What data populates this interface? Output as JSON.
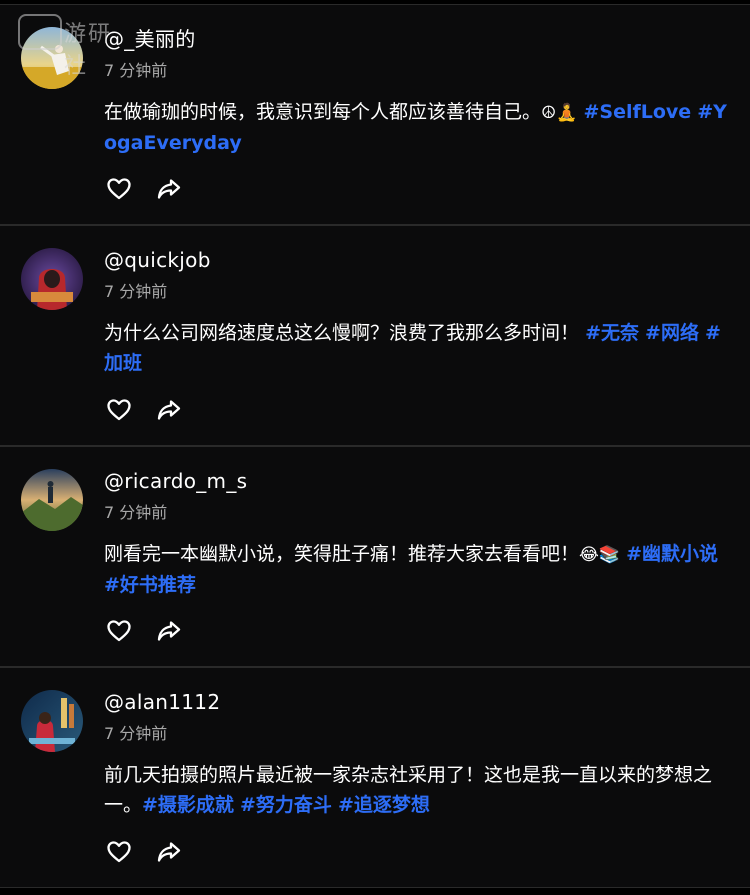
{
  "posts": [
    {
      "username": "@_美丽的",
      "time": "7 分钟前",
      "text": "在做瑜珈的时候，我意识到每个人都应该善待自己。",
      "emoji": "☮🧘",
      "tags": [
        "#SelfLove",
        "#YogaEveryday"
      ]
    },
    {
      "username": "@quickjob",
      "time": "7 分钟前",
      "text": "为什么公司网络速度总这么慢啊？浪费了我那么多时间！",
      "emoji": "",
      "tags": [
        "#无奈",
        "#网络",
        "#加班"
      ]
    },
    {
      "username": "@ricardo_m_s",
      "time": "7 分钟前",
      "text": "刚看完一本幽默小说，笑得肚子痛！推荐大家去看看吧！",
      "emoji": "😂📚",
      "tags": [
        "#幽默小说",
        "#好书推荐"
      ]
    },
    {
      "username": "@alan1112",
      "time": "7 分钟前",
      "text": "前几天拍摄的照片最近被一家杂志社采用了！这也是我一直以来的梦想之一。",
      "emoji": "",
      "tags": [
        "#摄影成就",
        "#努力奋斗",
        "#追逐梦想"
      ]
    }
  ],
  "watermark": {
    "text": "游研社"
  },
  "colors": {
    "background": "#000000",
    "card": "#0b0b0c",
    "hashtag": "#2d6df6",
    "time": "#a8a8a8"
  },
  "icons": {
    "like": "heart-outline-icon",
    "share": "share-arrow-icon"
  }
}
